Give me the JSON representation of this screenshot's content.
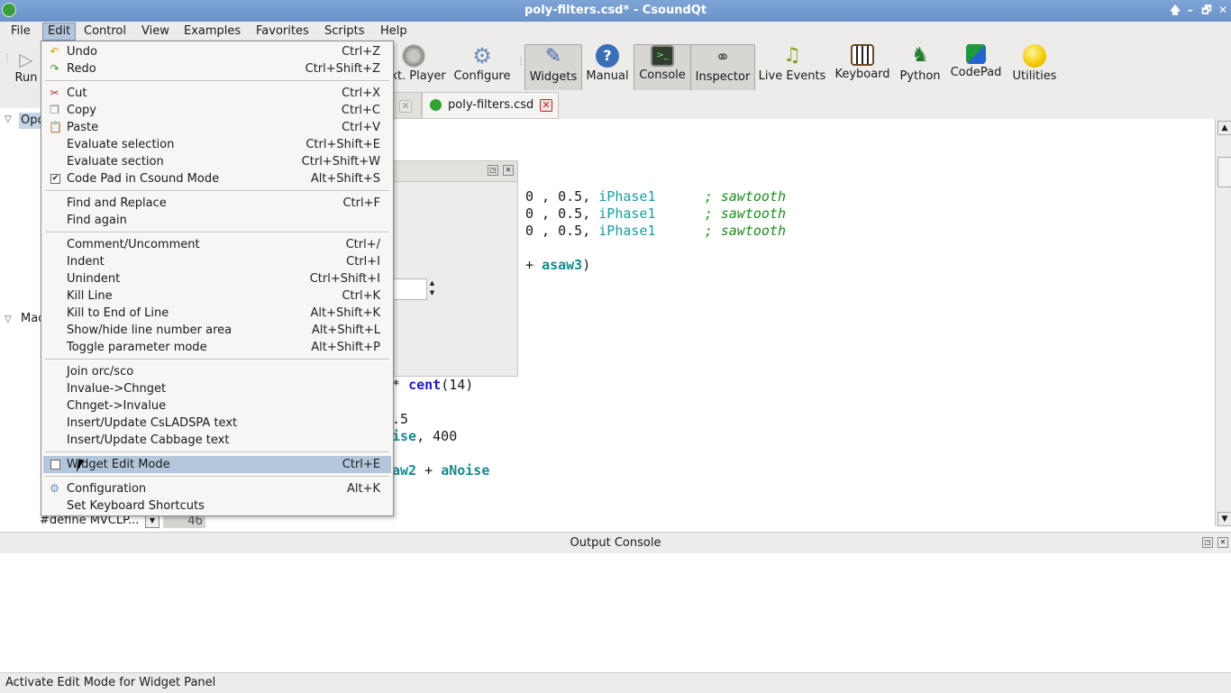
{
  "window": {
    "title": "poly-filters.csd* - CsoundQt",
    "up_glyph": "🡅",
    "min_glyph": "–",
    "max_glyph": "🗗",
    "close_glyph": "✕"
  },
  "menubar": [
    "File",
    "Edit",
    "Control",
    "View",
    "Examples",
    "Favorites",
    "Scripts",
    "Help"
  ],
  "toolbar": {
    "run": "Run",
    "ext_player": "xt. Player",
    "configure": "Configure",
    "widgets": "Widgets",
    "manual": "Manual",
    "console": "Console",
    "inspector": "Inspector",
    "live_events": "Live Events",
    "keyboard": "Keyboard",
    "python": "Python",
    "codepad": "CodePad",
    "utilities": "Utilities"
  },
  "tabs": {
    "active_label": "poly-filters.csd",
    "active_color": "#2fa52f"
  },
  "inspector": {
    "opcodes_label": "Opc",
    "macros_label": "Mac",
    "define_text": "#define MVCLP...",
    "line_number": "46"
  },
  "editor": {
    "l1": {
      "a": "0 , 0.5, ",
      "b": "iPhase1",
      "c": "; sawtooth"
    },
    "l2": {
      "a": "0 , 0.5, ",
      "b": "iPhase1",
      "c": "; sawtooth"
    },
    "l3": {
      "a": "0 , 0.5, ",
      "b": "iPhase1",
      "c": "; sawtooth"
    },
    "l4": {
      "a": "+ ",
      "b": "asaw3",
      "c": ")"
    },
    "l5": {
      "a": "* ",
      "b": "cent",
      "c": "(14)"
    },
    "l6": {
      "a": ".5"
    },
    "l7": {
      "a": "ise",
      "b": ", 400"
    },
    "l8": {
      "a": "aw2",
      "b": " + ",
      "c": "aNoise"
    }
  },
  "edit_menu": {
    "items": [
      {
        "label": "Undo",
        "shortcut": "Ctrl+Z",
        "icon": "undo-icon"
      },
      {
        "label": "Redo",
        "shortcut": "Ctrl+Shift+Z",
        "icon": "redo-icon"
      },
      {
        "label": "Cut",
        "shortcut": "Ctrl+X",
        "icon": "scissors-icon"
      },
      {
        "label": "Copy",
        "shortcut": "Ctrl+C",
        "icon": "copy-icon"
      },
      {
        "label": "Paste",
        "shortcut": "Ctrl+V",
        "icon": "clipboard-icon"
      },
      {
        "label": "Evaluate selection",
        "shortcut": "Ctrl+Shift+E"
      },
      {
        "label": "Evaluate section",
        "shortcut": "Ctrl+Shift+W"
      },
      {
        "label": "Code Pad in Csound Mode",
        "shortcut": "Alt+Shift+S",
        "checked": true
      },
      {
        "label": "Find and Replace",
        "shortcut": "Ctrl+F"
      },
      {
        "label": "Find again",
        "shortcut": ""
      },
      {
        "label": "Comment/Uncomment",
        "shortcut": "Ctrl+/"
      },
      {
        "label": "Indent",
        "shortcut": "Ctrl+I"
      },
      {
        "label": "Unindent",
        "shortcut": "Ctrl+Shift+I"
      },
      {
        "label": "Kill Line",
        "shortcut": "Ctrl+K"
      },
      {
        "label": "Kill to End of Line",
        "shortcut": "Alt+Shift+K"
      },
      {
        "label": "Show/hide line number area",
        "shortcut": "Alt+Shift+L"
      },
      {
        "label": "Toggle parameter mode",
        "shortcut": "Alt+Shift+P"
      },
      {
        "label": "Join orc/sco",
        "shortcut": ""
      },
      {
        "label": "Invalue->Chnget",
        "shortcut": ""
      },
      {
        "label": "Chnget->Invalue",
        "shortcut": ""
      },
      {
        "label": "Insert/Update CsLADSPA text",
        "shortcut": ""
      },
      {
        "label": "Insert/Update Cabbage text",
        "shortcut": ""
      },
      {
        "label": "Widget Edit Mode",
        "shortcut": "Ctrl+E",
        "checked": false,
        "highlighted": true
      },
      {
        "label": "Configuration",
        "shortcut": "Alt+K",
        "icon": "gear-icon"
      },
      {
        "label": "Set Keyboard Shortcuts",
        "shortcut": ""
      }
    ]
  },
  "output_console": {
    "title": "Output Console"
  },
  "status": "Activate Edit Mode for Widget Panel"
}
